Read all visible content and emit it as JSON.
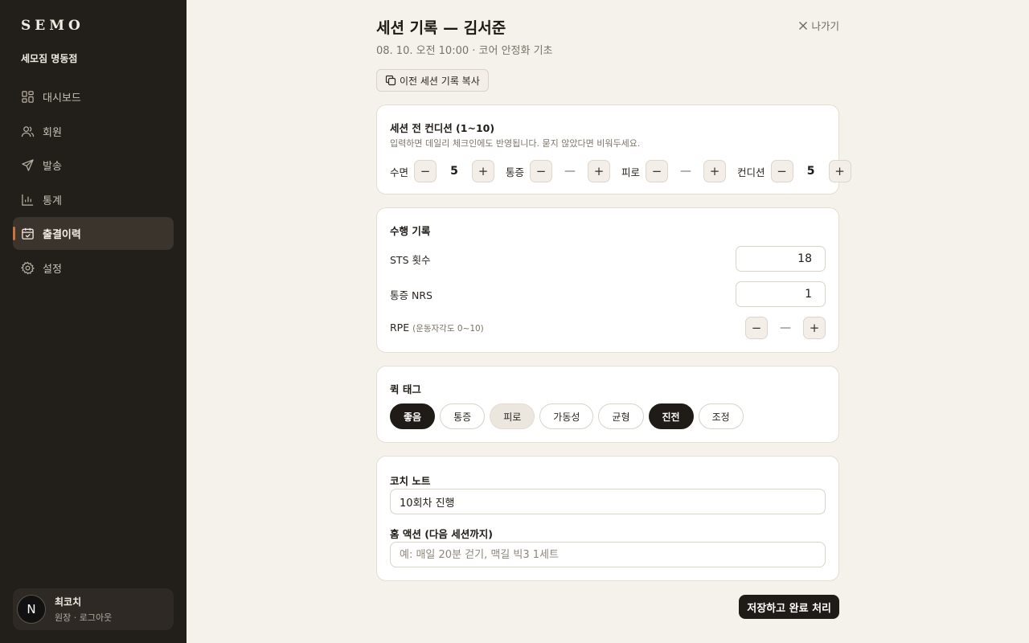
{
  "sidebar": {
    "brand": "SEMO",
    "gym": "세모짐 명동점",
    "items": [
      {
        "label": "대시보드",
        "icon": "dashboard-icon"
      },
      {
        "label": "회원",
        "icon": "users-icon"
      },
      {
        "label": "발송",
        "icon": "send-icon"
      },
      {
        "label": "통계",
        "icon": "chart-icon"
      },
      {
        "label": "출결이력",
        "icon": "calendar-check-icon",
        "active": true
      },
      {
        "label": "설정",
        "icon": "gear-icon"
      }
    ],
    "profile": {
      "initial": "N",
      "name": "최코치",
      "role": "원장 · 로그아웃"
    }
  },
  "header": {
    "title": "세션 기록 — 김서준",
    "subtitle": "08. 10. 오전 10:00 · 코어 안정화 기초",
    "exit_label": "나가기",
    "copy_label": "이전 세션 기록 복사"
  },
  "condition": {
    "title": "세션 전 컨디션 (1~10)",
    "desc": "입력하면 데일리 체크인에도 반영됩니다. 묻지 않았다면 비워두세요.",
    "items": [
      {
        "label": "수면",
        "value": "5"
      },
      {
        "label": "통증",
        "value": "—"
      },
      {
        "label": "피로",
        "value": "—"
      },
      {
        "label": "컨디션",
        "value": "5"
      }
    ]
  },
  "performance": {
    "title": "수행 기록",
    "sts_label": "STS 횟수",
    "sts_value": "18",
    "nrs_label": "통증 NRS",
    "nrs_value": "1",
    "rpe_label": "RPE",
    "rpe_hint": "(운동자각도 0~10)",
    "rpe_value": "—"
  },
  "tags": {
    "title": "퀵 태그",
    "items": [
      {
        "label": "좋음",
        "state": "on"
      },
      {
        "label": "통증",
        "state": "off"
      },
      {
        "label": "피로",
        "state": "soft"
      },
      {
        "label": "가동성",
        "state": "off"
      },
      {
        "label": "균형",
        "state": "off"
      },
      {
        "label": "진전",
        "state": "on"
      },
      {
        "label": "조정",
        "state": "off"
      }
    ]
  },
  "notes": {
    "coach_label": "코치 노트",
    "coach_value": "10회차 진행",
    "home_label": "홈 액션 (다음 세션까지)",
    "home_placeholder": "예: 매일 20분 걷기, 맥길 빅3 1세트"
  },
  "footer": {
    "save_label": "저장하고 완료 처리"
  },
  "colors": {
    "sidebar_bg": "#221e19",
    "accent": "#c9733d",
    "page_bg": "#f5f2ec",
    "primary": "#1f1b16"
  }
}
